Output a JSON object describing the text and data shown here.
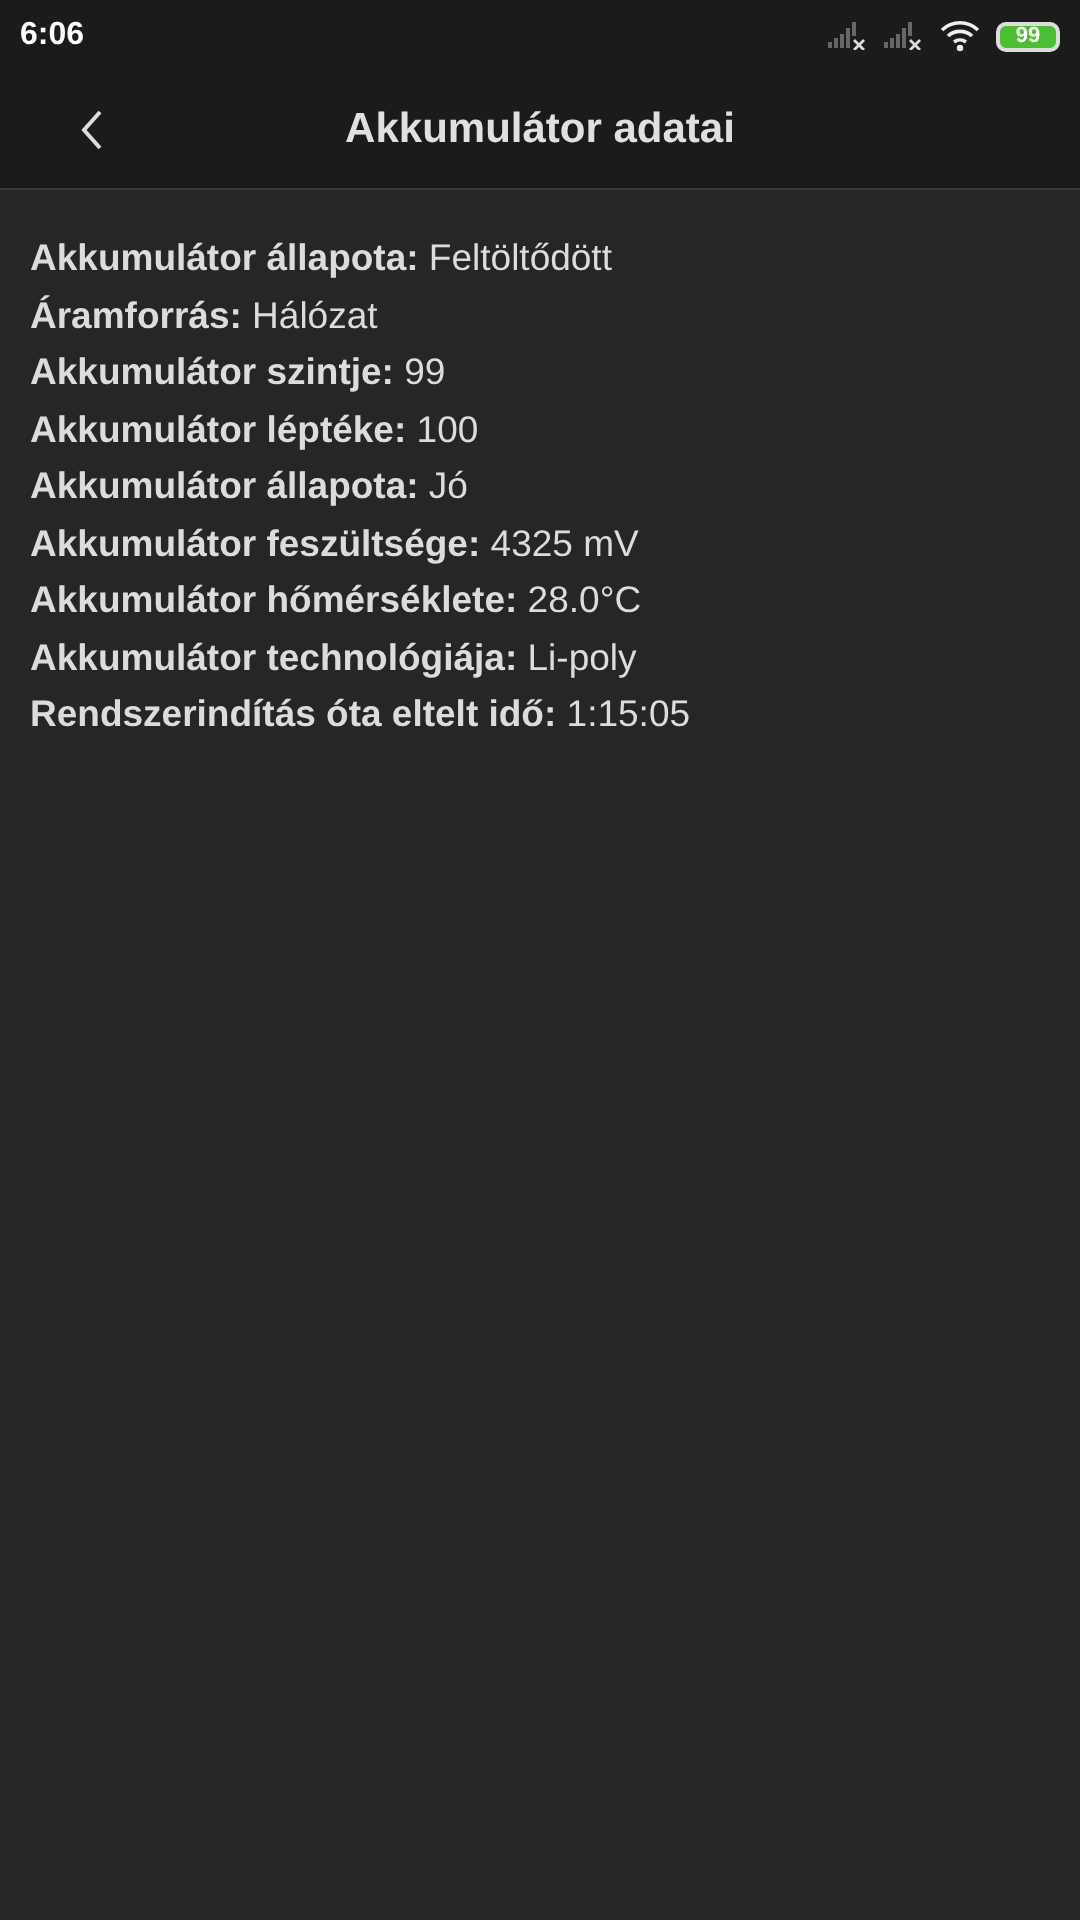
{
  "status_bar": {
    "time": "6:06",
    "battery": "99"
  },
  "header": {
    "title": "Akkumulátor adatai"
  },
  "details": [
    "**Akkumulátor állapota:** Feltöltődött",
    "**Áramforrás:** Hálózat",
    "**Akkumulátor szintje:** 99",
    "**Akkumulátor léptéke:** 100",
    "**Akkumulátor állapota:** Jó",
    "**Akkumulátor feszültsége:** 4325 mV",
    "**Akkumulátor hőmérséklete:** 28.0°C",
    "**Akkumulátor technológiája:** Li-poly",
    "**Rendszerindítás óta eltelt idő:** 1:15:05"
  ]
}
